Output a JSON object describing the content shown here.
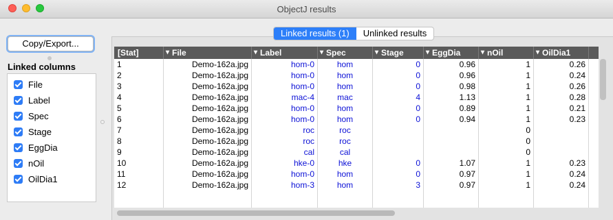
{
  "window": {
    "title": "ObjectJ results"
  },
  "left": {
    "copy_export_label": "Copy/Export...",
    "linked_columns_title": "Linked columns",
    "columns": [
      "File",
      "Label",
      "Spec",
      "Stage",
      "EggDia",
      "nOil",
      "OilDia1"
    ]
  },
  "tabs": [
    "Linked results (1)",
    "Unlinked results"
  ],
  "table": {
    "headers": [
      "[Stat]",
      "File",
      "Label",
      "Spec",
      "Stage",
      "EggDia",
      "nOil",
      "OilDia1"
    ],
    "rows": [
      [
        "1",
        "Demo-162a.jpg",
        "hom-0",
        "hom",
        "0",
        "0.96",
        "1",
        "0.26"
      ],
      [
        "2",
        "Demo-162a.jpg",
        "hom-0",
        "hom",
        "0",
        "0.96",
        "1",
        "0.24"
      ],
      [
        "3",
        "Demo-162a.jpg",
        "hom-0",
        "hom",
        "0",
        "0.98",
        "1",
        "0.26"
      ],
      [
        "4",
        "Demo-162a.jpg",
        "mac-4",
        "mac",
        "4",
        "1.13",
        "1",
        "0.28"
      ],
      [
        "5",
        "Demo-162a.jpg",
        "hom-0",
        "hom",
        "0",
        "0.89",
        "1",
        "0.21"
      ],
      [
        "6",
        "Demo-162a.jpg",
        "hom-0",
        "hom",
        "0",
        "0.94",
        "1",
        "0.23"
      ],
      [
        "7",
        "Demo-162a.jpg",
        "roc",
        "roc",
        "",
        "",
        "0",
        ""
      ],
      [
        "8",
        "Demo-162a.jpg",
        "roc",
        "roc",
        "",
        "",
        "0",
        ""
      ],
      [
        "9",
        "Demo-162a.jpg",
        "cal",
        "cal",
        "",
        "",
        "0",
        ""
      ],
      [
        "10",
        "Demo-162a.jpg",
        "hke-0",
        "hke",
        "0",
        "1.07",
        "1",
        "0.23"
      ],
      [
        "11",
        "Demo-162a.jpg",
        "hom-0",
        "hom",
        "0",
        "0.97",
        "1",
        "0.24"
      ],
      [
        "12",
        "Demo-162a.jpg",
        "hom-3",
        "hom",
        "3",
        "0.97",
        "1",
        "0.24"
      ]
    ]
  }
}
